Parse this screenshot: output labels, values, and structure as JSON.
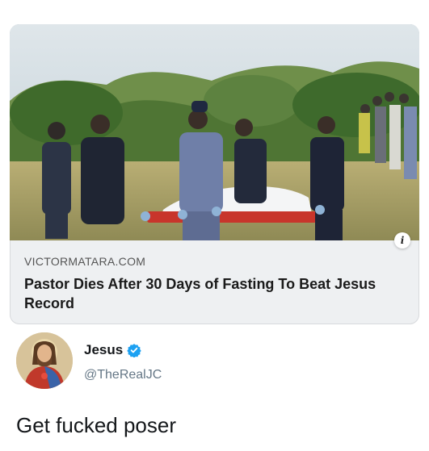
{
  "card": {
    "source": "VICTORMATARA.COM",
    "headline": "Pastor Dies After 30 Days of Fasting To Beat Jesus Record",
    "info_icon": "i"
  },
  "author": {
    "display_name": "Jesus",
    "handle": "@TheRealJC",
    "verified_color": "#1da1f2"
  },
  "tweet": {
    "text": "Get fucked poser"
  }
}
